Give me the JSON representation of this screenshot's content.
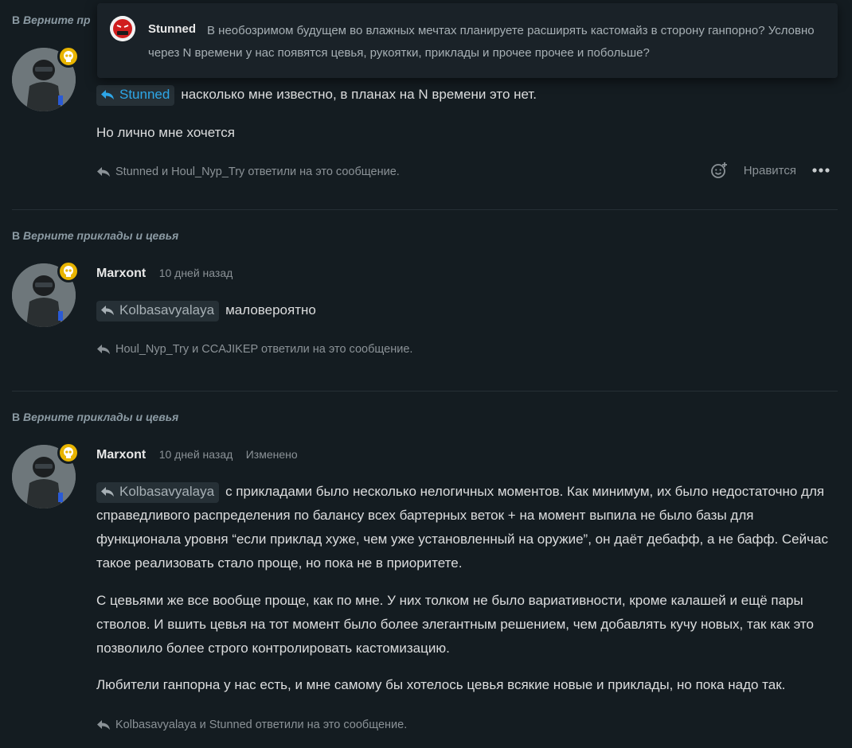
{
  "popup": {
    "author": "Stunned",
    "text": "В необозримом будущем во влажных мечтах планируете расширять кастомайз в сторону ганпорно? Условно через N времени у нас появятся цевья, рукоятки, приклады и прочее прочее и побольше?"
  },
  "posts": [
    {
      "topic_prefix": "В",
      "topic_name": "Верните пр",
      "mention": "Stunned",
      "paragraphs": [
        "насколько мне известно, в планах на N времени это нет.",
        "Но лично мне хочется"
      ],
      "replies": "Stunned и Houl_Nyp_Try ответили на это сообщение.",
      "like_label": "Нравится"
    },
    {
      "topic_prefix": "В",
      "topic_name": "Верните приклады и цевья",
      "author": "Marxont",
      "time": "10 дней назад",
      "mention": "Kolbasavyalaya",
      "text": "маловероятно",
      "replies": "Houl_Nyp_Try и CCAJIKEP ответили на это сообщение."
    },
    {
      "topic_prefix": "В",
      "topic_name": "Верните приклады и цевья",
      "author": "Marxont",
      "time": "10 дней назад",
      "edited": "Изменено",
      "mention": "Kolbasavyalaya",
      "paragraphs": [
        "с прикладами было несколько нелогичных моментов. Как минимум, их было недостаточно для справедливого распределения по балансу всех бартерных веток + на момент выпила не было базы для функционала уровня “если приклад хуже, чем уже установленный на оружие”, он даёт дебафф, а не бафф. Сейчас такое реализовать стало проще, но пока не в приоритете.",
        "С цевьями же все вообще проще, как по мне. У них толком не было вариативности, кроме калашей и ещё пары стволов. И вшить цевья на тот момент было более элегантным решением, чем добавлять кучу новых, так как это позволило более строго контролировать кастомизацию.",
        "Любители ганпорна у нас есть, и мне самому бы хотелось цевья всякие новые и приклады, но пока надо так."
      ],
      "replies": "Kolbasavyalaya и Stunned ответили на это сообщение."
    }
  ],
  "colors": {
    "background": "#141c21",
    "mention_active": "#2ea7e8",
    "badge": "#e8b400"
  }
}
